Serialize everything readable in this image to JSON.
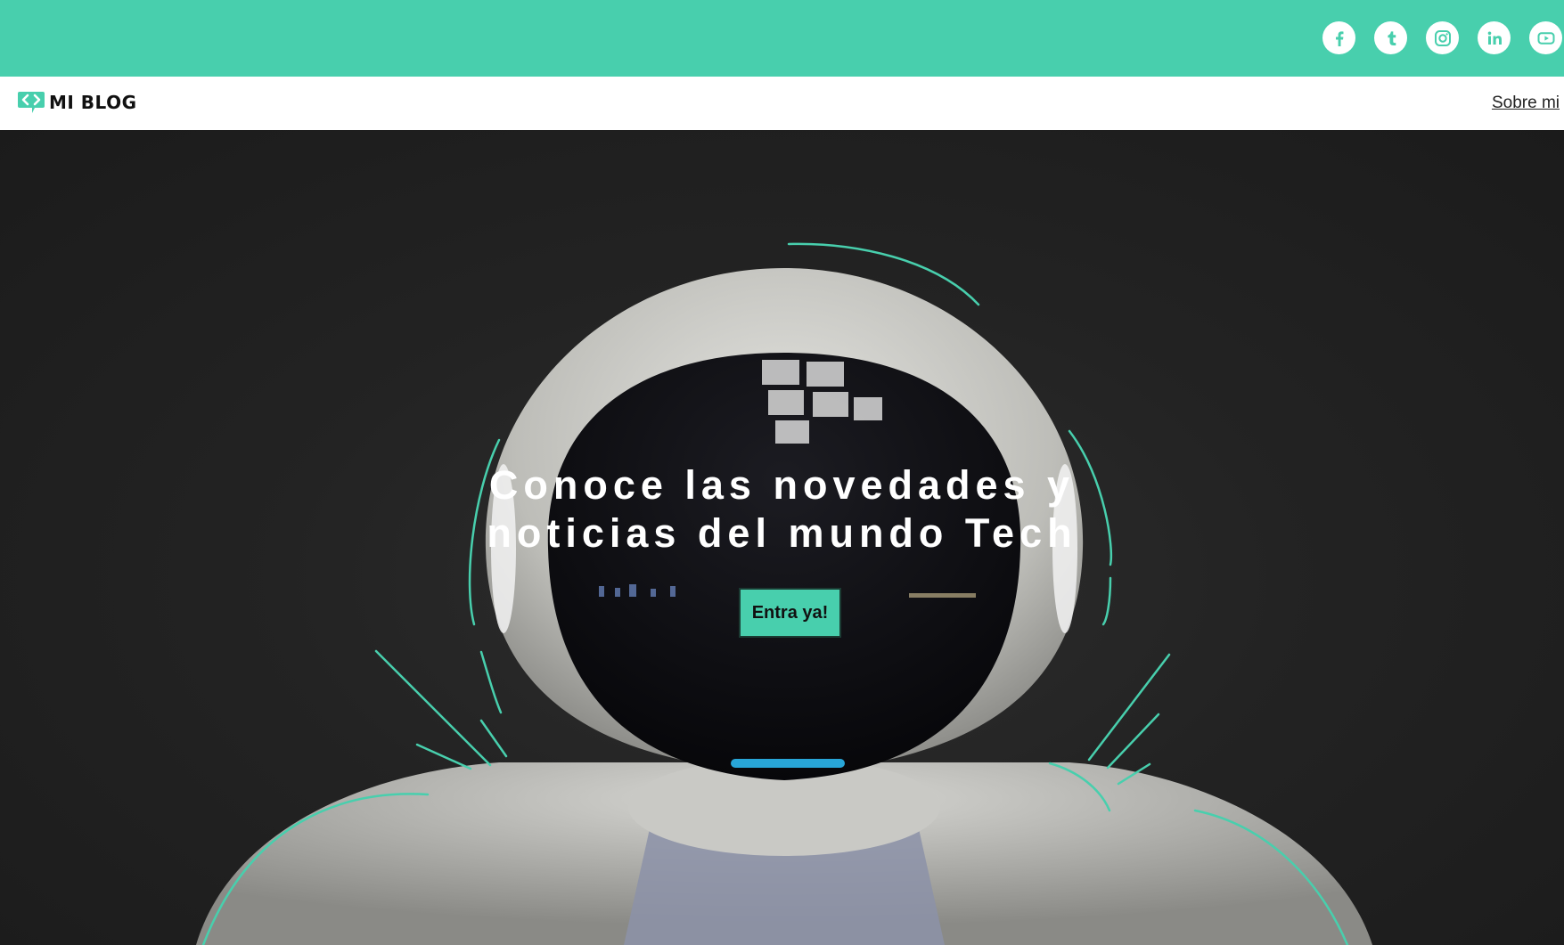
{
  "colors": {
    "accent": "#48cfad",
    "dark": "#202020",
    "white": "#ffffff"
  },
  "social": [
    {
      "name": "facebook-icon"
    },
    {
      "name": "tumblr-icon"
    },
    {
      "name": "instagram-icon"
    },
    {
      "name": "linkedin-icon"
    },
    {
      "name": "youtube-icon"
    }
  ],
  "nav": {
    "logo_text": "MI BLOG",
    "logo_icon": "code-chat-icon",
    "about_label": "Sobre mi"
  },
  "hero": {
    "title_line1": "Conoce las novedades y",
    "title_line2": "noticias del mundo Tech",
    "cta_label": "Entra ya!",
    "image": "robot-astronaut-illustration"
  }
}
